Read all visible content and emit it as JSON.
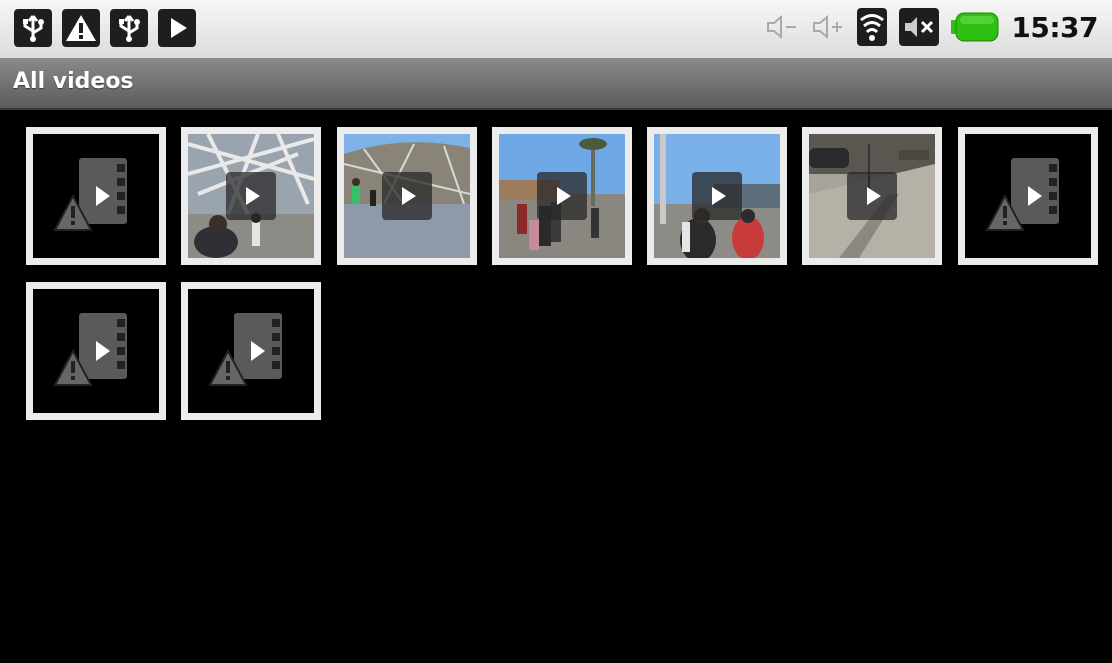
{
  "status_bar": {
    "left_icons": [
      "usb-icon",
      "warning-icon",
      "usb-icon",
      "play-store-icon"
    ],
    "right_icons": [
      "volume-down-icon",
      "volume-up-icon",
      "wifi-icon",
      "mute-icon",
      "battery-icon"
    ],
    "time": "15:37",
    "battery_color": "#2fbf12"
  },
  "action_bar": {
    "title": "All videos"
  },
  "videos": [
    {
      "kind": "error"
    },
    {
      "kind": "photo",
      "scene": "stadium-lattice-people"
    },
    {
      "kind": "photo",
      "scene": "stadium-plaza"
    },
    {
      "kind": "photo",
      "scene": "palm-plaza-crowd"
    },
    {
      "kind": "photo",
      "scene": "lamppost-crowd-red"
    },
    {
      "kind": "photo",
      "scene": "street-pavement"
    },
    {
      "kind": "error"
    },
    {
      "kind": "error"
    },
    {
      "kind": "error"
    }
  ]
}
